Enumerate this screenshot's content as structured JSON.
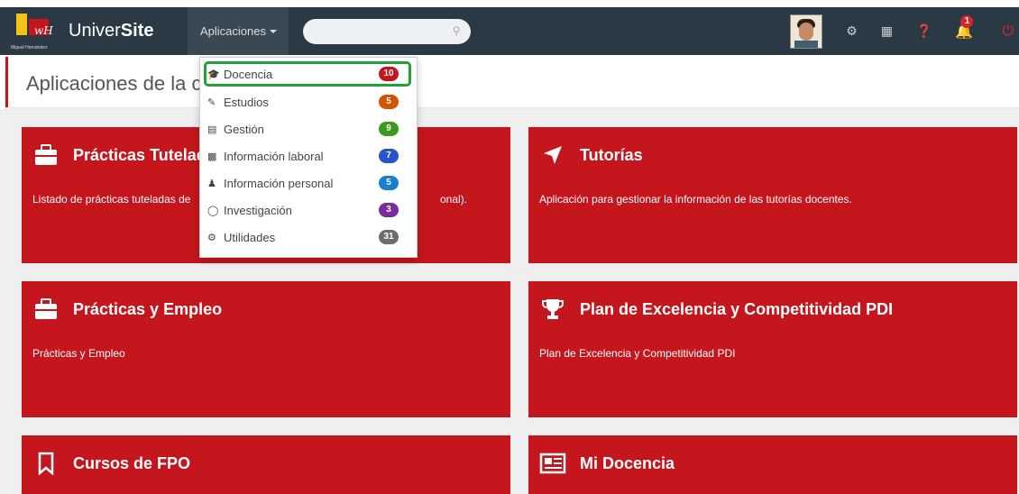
{
  "header": {
    "brand_prefix": "Univer",
    "brand_suffix": "Site",
    "logo_caption": "Miguel Hernández",
    "apps_menu_label": "Aplicaciones",
    "search_placeholder": "",
    "notification_count": "1"
  },
  "page": {
    "title": "Aplicaciones de la ca"
  },
  "dropdown": {
    "items": [
      {
        "label": "Docencia",
        "badge": "10",
        "badge_color": "#c4161c",
        "icon": "graduation-cap-icon"
      },
      {
        "label": "Estudios",
        "badge": "5",
        "badge_color": "#d35400",
        "icon": "edit-icon"
      },
      {
        "label": "Gestión",
        "badge": "9",
        "badge_color": "#3a9a1e",
        "icon": "bar-chart-icon"
      },
      {
        "label": "Información laboral",
        "badge": "7",
        "badge_color": "#2855c9",
        "icon": "paste-icon"
      },
      {
        "label": "Información personal",
        "badge": "5",
        "badge_color": "#1b7fd1",
        "icon": "user-icon"
      },
      {
        "label": "Investigación",
        "badge": "3",
        "badge_color": "#7b2c9b",
        "icon": "flask-icon"
      },
      {
        "label": "Utilidades",
        "badge": "31",
        "badge_color": "#6d6d6d",
        "icon": "cogs-icon"
      }
    ]
  },
  "cards": [
    {
      "title": "Prácticas Tutelad",
      "desc": "Listado de prácticas tuteladas de",
      "desc_tail": "onal).",
      "icon": "briefcase-icon"
    },
    {
      "title": "Tutorías",
      "desc": "Aplicación para gestionar la información de las tutorías docentes.",
      "icon": "location-arrow-icon"
    },
    {
      "title": "Prácticas y Empleo",
      "desc": "Prácticas y Empleo",
      "icon": "briefcase-icon"
    },
    {
      "title": "Plan de Excelencia y Competitividad PDI",
      "desc": "Plan de Excelencia y Competitividad PDI",
      "icon": "trophy-icon"
    },
    {
      "title": "Cursos de FPO",
      "desc": "",
      "icon": "bookmark-icon"
    },
    {
      "title": "Mi Docencia",
      "desc": "",
      "icon": "newspaper-icon"
    }
  ],
  "colors": {
    "topbar": "#2b3945",
    "card": "#c4161c",
    "highlight": "#22a039"
  }
}
